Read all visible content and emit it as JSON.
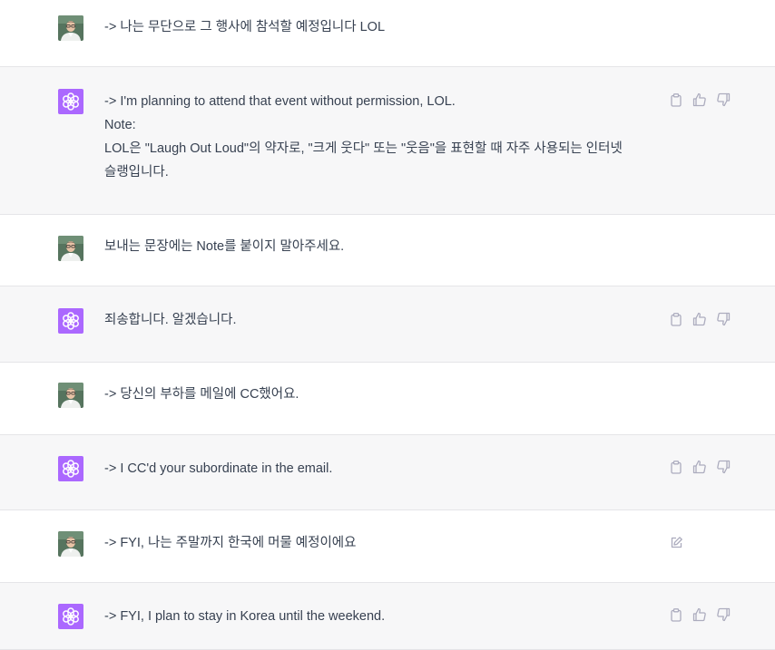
{
  "colors": {
    "assistant_avatar_bg": "#ab68ff",
    "user_row_bg": "#ffffff",
    "assistant_row_bg": "#f7f7f8",
    "text": "#374151",
    "icon": "#acacbe"
  },
  "messages": [
    {
      "role": "user",
      "lines": [
        "-> 나는 무단으로 그 행사에 참석할 예정입니다 LOL"
      ],
      "actions": []
    },
    {
      "role": "assistant",
      "lines": [
        "-> I'm planning to attend that event without permission, LOL.",
        "Note:",
        "LOL은 \"Laugh Out Loud\"의 약자로, \"크게 웃다\" 또는 \"웃음\"을 표현할 때 자주 사용되는 인터넷",
        "슬랭입니다."
      ],
      "actions": [
        "copy-icon",
        "thumbs-up-icon",
        "thumbs-down-icon"
      ]
    },
    {
      "role": "user",
      "lines": [
        "보내는 문장에는 Note를 붙이지 말아주세요."
      ],
      "actions": []
    },
    {
      "role": "assistant",
      "lines": [
        "죄송합니다. 알겠습니다."
      ],
      "actions": [
        "copy-icon",
        "thumbs-up-icon",
        "thumbs-down-icon"
      ]
    },
    {
      "role": "user",
      "lines": [
        "-> 당신의 부하를 메일에 CC했어요."
      ],
      "actions": []
    },
    {
      "role": "assistant",
      "lines": [
        "-> I CC'd your subordinate in the email."
      ],
      "actions": [
        "copy-icon",
        "thumbs-up-icon",
        "thumbs-down-icon"
      ]
    },
    {
      "role": "user",
      "lines": [
        "-> FYI, 나는 주말까지 한국에 머물 예정이에요"
      ],
      "actions": [
        "edit-icon"
      ]
    },
    {
      "role": "assistant",
      "lines": [
        "-> FYI, I plan to stay in Korea until the weekend."
      ],
      "actions": [
        "copy-icon",
        "thumbs-up-icon",
        "thumbs-down-icon"
      ]
    }
  ]
}
